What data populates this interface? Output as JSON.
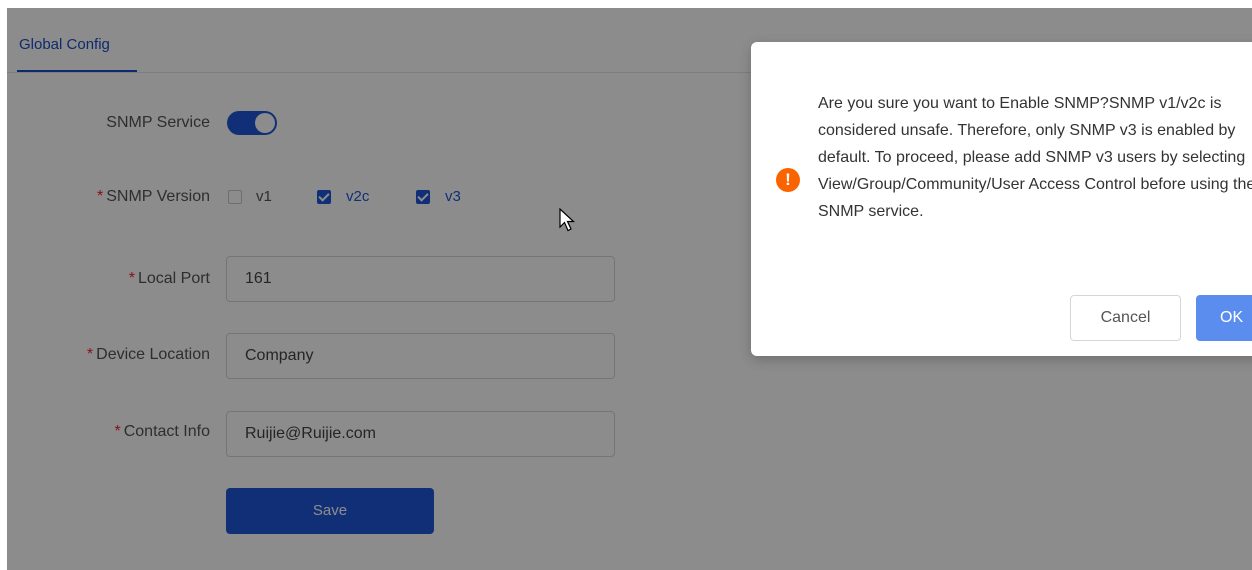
{
  "tabs": {
    "active": "Global Config"
  },
  "form": {
    "snmp_service": {
      "label": "SNMP Service",
      "enabled": true
    },
    "snmp_version": {
      "label": "SNMP Version",
      "options": [
        {
          "label": "v1",
          "checked": false
        },
        {
          "label": "v2c",
          "checked": true
        },
        {
          "label": "v3",
          "checked": true
        }
      ]
    },
    "local_port": {
      "label": "Local Port",
      "value": "161"
    },
    "device_location": {
      "label": "Device Location",
      "value": "Company"
    },
    "contact_info": {
      "label": "Contact Info",
      "value": "Ruijie@Ruijie.com"
    },
    "required_mark": "*",
    "save_label": "Save"
  },
  "dialog": {
    "icon": "warning-icon",
    "message": "Are you sure you want to Enable SNMP?SNMP v1/v2c is considered unsafe. Therefore, only SNMP v3 is enabled by default. To proceed, please add SNMP v3 users by selecting View/Group/Community/User Access Control before using the SNMP service.",
    "cancel_label": "Cancel",
    "ok_label": "OK"
  },
  "colors": {
    "primary": "#1f57d9",
    "warning": "#fa6400",
    "required": "#f5222d"
  }
}
